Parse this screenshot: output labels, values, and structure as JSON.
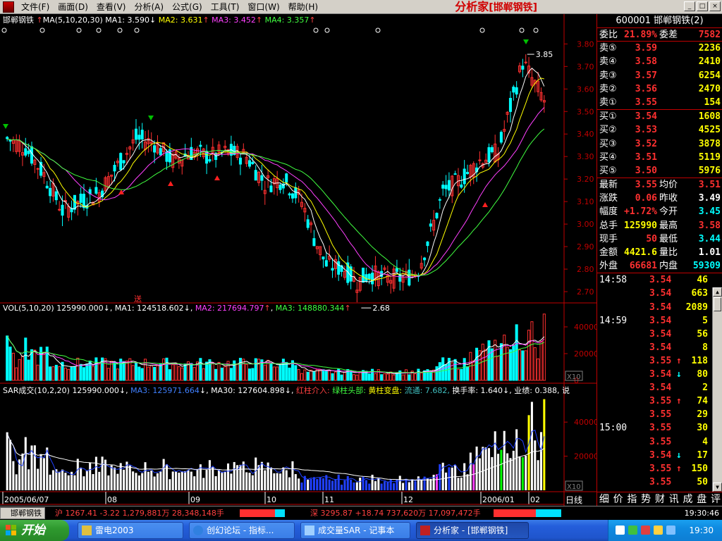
{
  "menubar": {
    "items": [
      "文件(F)",
      "画面(D)",
      "查看(V)",
      "分析(A)",
      "公式(G)",
      "工具(T)",
      "窗口(W)",
      "帮助(H)"
    ],
    "brand": "分析家",
    "brand_sub": "[邯郸钢铁]",
    "win_buttons": [
      "_",
      "□",
      "×"
    ]
  },
  "price_panel": {
    "legend": {
      "stock": "邯郸钢铁",
      "ma_def": "MA(5,10,20,30)",
      "ma1": "MA1: 3.590",
      "ma2": "MA2: 3.631",
      "ma3": "MA3: 3.452",
      "ma4": "MA4: 3.357"
    },
    "y_ticks": [
      "3.80",
      "3.70",
      "3.60",
      "3.50",
      "3.40",
      "3.30",
      "3.20",
      "3.10",
      "3.00",
      "2.90",
      "2.80",
      "2.70"
    ],
    "high_label": "3.85",
    "low_label": "2.68",
    "weight_marker": "送",
    "ylim": [
      2.65,
      3.87
    ]
  },
  "vol_panel": {
    "legend": {
      "def": "VOL(5,10,20)",
      "val": "125990.000",
      "ma1": "MA1: 124518.602",
      "ma2": "MA2: 217694.797",
      "ma3": "MA3: 148880.344"
    },
    "y_ticks": [
      "40000",
      "20000",
      "0"
    ],
    "unit": "X10"
  },
  "sar_panel": {
    "legend": {
      "def": "SAR成交(10,2,20)",
      "val": "125990.000",
      "ma3": "MA3: 125971.664",
      "ma30": "MA30: 127604.898",
      "l1": "红柱介入:",
      "l2": "绿柱头部:",
      "l3": "黄柱变盘:",
      "l4": "流通: 7.682,",
      "l5": "换手率: 1.640",
      "l6": "业绩: 0.388,",
      "l7": "说"
    },
    "y_ticks": [
      "40000",
      "20000"
    ],
    "unit": "X10",
    "period_label": "日线"
  },
  "x_labels": [
    "2005/06/07",
    "08",
    "09",
    "10",
    "11",
    "12",
    "2006/01",
    "02"
  ],
  "quote": {
    "title": "600001 邯郸钢铁(2)",
    "weibi_label": "委比",
    "weibi": "21.89%",
    "weicha_label": "委差",
    "weicha": "7582",
    "asks": [
      {
        "label": "卖⑤",
        "price": "3.59",
        "vol": "2236"
      },
      {
        "label": "卖④",
        "price": "3.58",
        "vol": "2410"
      },
      {
        "label": "卖③",
        "price": "3.57",
        "vol": "6254"
      },
      {
        "label": "卖②",
        "price": "3.56",
        "vol": "2470"
      },
      {
        "label": "卖①",
        "price": "3.55",
        "vol": "154"
      }
    ],
    "bids": [
      {
        "label": "买①",
        "price": "3.54",
        "vol": "1608"
      },
      {
        "label": "买②",
        "price": "3.53",
        "vol": "4525"
      },
      {
        "label": "买③",
        "price": "3.52",
        "vol": "3878"
      },
      {
        "label": "买④",
        "price": "3.51",
        "vol": "5119"
      },
      {
        "label": "买⑤",
        "price": "3.50",
        "vol": "5976"
      }
    ],
    "stats": [
      {
        "l1": "最新",
        "v1": "3.55",
        "l2": "均价",
        "v2": "3.51",
        "c1": "c-red",
        "c2": "c-red"
      },
      {
        "l1": "涨跌",
        "v1": "0.06",
        "l2": "昨收",
        "v2": "3.49",
        "c1": "c-red",
        "c2": "c-white"
      },
      {
        "l1": "幅度",
        "v1": "+1.72%",
        "l2": "今开",
        "v2": "3.45",
        "c1": "c-red",
        "c2": "c-cyan"
      },
      {
        "l1": "总手",
        "v1": "125990",
        "l2": "最高",
        "v2": "3.58",
        "c1": "c-yellow",
        "c2": "c-red"
      },
      {
        "l1": "现手",
        "v1": "50",
        "l2": "最低",
        "v2": "3.44",
        "c1": "c-red",
        "c2": "c-cyan"
      },
      {
        "l1": "金额",
        "v1": "4421.6",
        "l2": "量比",
        "v2": "1.01",
        "c1": "c-yellow",
        "c2": "c-white"
      },
      {
        "l1": "外盘",
        "v1": "66681",
        "l2": "内盘",
        "v2": "59309",
        "c1": "c-red",
        "c2": "c-cyan"
      }
    ],
    "ticks": [
      {
        "time": "14:58",
        "price": "3.54",
        "arrow": "",
        "vol": "46"
      },
      {
        "time": "",
        "price": "3.54",
        "arrow": "",
        "vol": "663"
      },
      {
        "time": "",
        "price": "3.54",
        "arrow": "",
        "vol": "2089"
      },
      {
        "time": "14:59",
        "price": "3.54",
        "arrow": "",
        "vol": "5"
      },
      {
        "time": "",
        "price": "3.54",
        "arrow": "",
        "vol": "56"
      },
      {
        "time": "",
        "price": "3.54",
        "arrow": "",
        "vol": "8"
      },
      {
        "time": "",
        "price": "3.55",
        "arrow": "↑",
        "vol": "118"
      },
      {
        "time": "",
        "price": "3.54",
        "arrow": "↓",
        "vol": "80"
      },
      {
        "time": "",
        "price": "3.54",
        "arrow": "",
        "vol": "2"
      },
      {
        "time": "",
        "price": "3.55",
        "arrow": "↑",
        "vol": "74"
      },
      {
        "time": "",
        "price": "3.55",
        "arrow": "",
        "vol": "29"
      },
      {
        "time": "15:00",
        "price": "3.55",
        "arrow": "",
        "vol": "30"
      },
      {
        "time": "",
        "price": "3.55",
        "arrow": "",
        "vol": "4"
      },
      {
        "time": "",
        "price": "3.54",
        "arrow": "↓",
        "vol": "17"
      },
      {
        "time": "",
        "price": "3.55",
        "arrow": "↑",
        "vol": "150"
      },
      {
        "time": "",
        "price": "3.55",
        "arrow": "",
        "vol": "50"
      }
    ],
    "tabs": [
      "细",
      "价",
      "指",
      "势",
      "财",
      "讯",
      "成",
      "盘",
      "评"
    ]
  },
  "statusbar": {
    "tab": "邯郸钢铁",
    "sh": "沪 1267.41  -3.22 1,279,881万 28,348,148手",
    "sz": "深 3295.87  +18.74 737,620万 17,097,472手",
    "clock": "19:30:46"
  },
  "taskbar": {
    "start": "开始",
    "tasks": [
      "雷电2003",
      "创幻论坛 - 指标...",
      "成交量SAR - 记事本",
      "分析家 - [邯郸钢铁]"
    ],
    "time": "19:30"
  },
  "colors": {
    "up": "#ff3030",
    "down": "#00ffff",
    "ma1": "#ffffff",
    "ma2": "#ffff00",
    "ma3": "#ff40ff",
    "ma4": "#40ff40",
    "border": "#c00000"
  }
}
